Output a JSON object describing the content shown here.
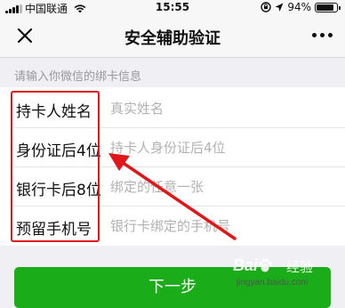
{
  "status_bar": {
    "carrier": "中国联通",
    "time": "15:55",
    "battery_percent": "94%",
    "battery_level": 0.94,
    "icons": [
      "signal-icon",
      "wifi-icon",
      "lock-rotation-icon",
      "location-arrow-icon",
      "battery-icon"
    ]
  },
  "nav": {
    "close_icon": "close-icon",
    "title": "安全辅助验证",
    "more_icon": "more-dots-icon"
  },
  "form": {
    "hint": "请输入你微信的绑卡信息",
    "rows": [
      {
        "label": "持卡人姓名",
        "placeholder": "真实姓名",
        "value": ""
      },
      {
        "label": "身份证后4位",
        "placeholder": "持卡人身份证后4位",
        "value": ""
      },
      {
        "label": "银行卡后8位",
        "placeholder": "绑定的任意一张",
        "value": ""
      },
      {
        "label": "预留手机号",
        "placeholder": "银行卡绑定的手机号",
        "value": ""
      }
    ]
  },
  "next_button": {
    "label": "下一步"
  },
  "watermark": {
    "brand_left": "Bai",
    "brand_right": "经验",
    "url": "jingyan.baidu.com"
  },
  "colors": {
    "accent_green": "#1aad19",
    "annotation_red": "#e0161b",
    "background": "#efeff4"
  }
}
